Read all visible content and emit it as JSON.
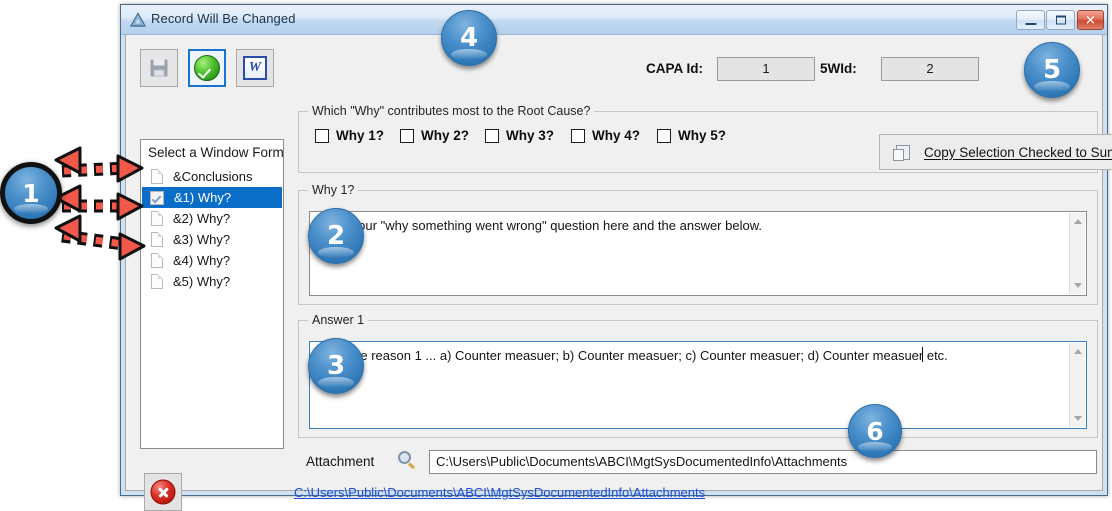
{
  "window": {
    "title": "Record Will Be Changed",
    "title_icon": "warning-triangle-icon",
    "minimize_label": "Minimize",
    "maximize_label": "Maximize",
    "close_label": "Close"
  },
  "toolbar": {
    "save_label": "Save",
    "save_icon": "floppy-disk-icon",
    "confirm_label": "Confirm",
    "confirm_icon": "green-check-icon",
    "word_label": "Export to Word",
    "word_icon": "word-document-icon",
    "word_glyph": "W"
  },
  "header": {
    "capa_id_label": "CAPA Id:",
    "capa_id_value": "1",
    "fivew_id_label": "5WId:",
    "fivew_id_value": "2"
  },
  "sidebar": {
    "header": "Select a Window Form",
    "items": [
      {
        "label": "&Conclusions",
        "icon": "document-icon",
        "selected": false,
        "checked": false
      },
      {
        "label": "&1) Why?",
        "icon": "checkbox-icon",
        "selected": true,
        "checked": true
      },
      {
        "label": "&2) Why?",
        "icon": "document-icon",
        "selected": false,
        "checked": false
      },
      {
        "label": "&3) Why?",
        "icon": "document-icon",
        "selected": false,
        "checked": false
      },
      {
        "label": "&4) Why?",
        "icon": "document-icon",
        "selected": false,
        "checked": false
      },
      {
        "label": "&5) Why?",
        "icon": "document-icon",
        "selected": false,
        "checked": false
      }
    ],
    "delete_label": "Delete",
    "delete_icon": "red-x-circle-icon"
  },
  "which_group": {
    "legend": "Which \"Why\" contributes most to the Root Cause?",
    "checkboxes": [
      {
        "label": "Why 1?",
        "checked": false
      },
      {
        "label": "Why 2?",
        "checked": false
      },
      {
        "label": "Why 3?",
        "checked": false
      },
      {
        "label": "Why 4?",
        "checked": false
      },
      {
        "label": "Why 5?",
        "checked": false
      }
    ],
    "copy_button_label": "Copy Selection Checked to Summary Conclusion",
    "copy_button_icon": "copy-icon"
  },
  "why_group": {
    "legend": "Why 1?",
    "value": "Enter your \"why something went wrong\" question here and the answer below."
  },
  "answer_group": {
    "legend": "Answer 1",
    "value": "Because reason 1 ... a) Counter measuer; b) Counter measuer; c) Counter measuer; d) Counter measuer etc."
  },
  "attachment": {
    "label": "Attachment",
    "browse_icon": "magnifier-icon",
    "path_value": "C:\\Users\\Public\\Documents\\ABCI\\MgtSysDocumentedInfo\\Attachments",
    "link_text": "C:\\Users\\Public\\Documents\\ABCI\\MgtSysDocumentedInfo\\Attachments"
  },
  "callouts": [
    {
      "id": "1",
      "target": "sidebar-list"
    },
    {
      "id": "2",
      "target": "why-textarea"
    },
    {
      "id": "3",
      "target": "answer-textarea"
    },
    {
      "id": "4",
      "target": "titlebar"
    },
    {
      "id": "5",
      "target": "header-fields"
    },
    {
      "id": "6",
      "target": "attachment-input"
    }
  ],
  "colors": {
    "accent": "#0a6dc7",
    "badge": "#2f79b8",
    "arrow": "#f2594b",
    "link": "#1a4fd6",
    "selection": "#0a6dc7"
  }
}
